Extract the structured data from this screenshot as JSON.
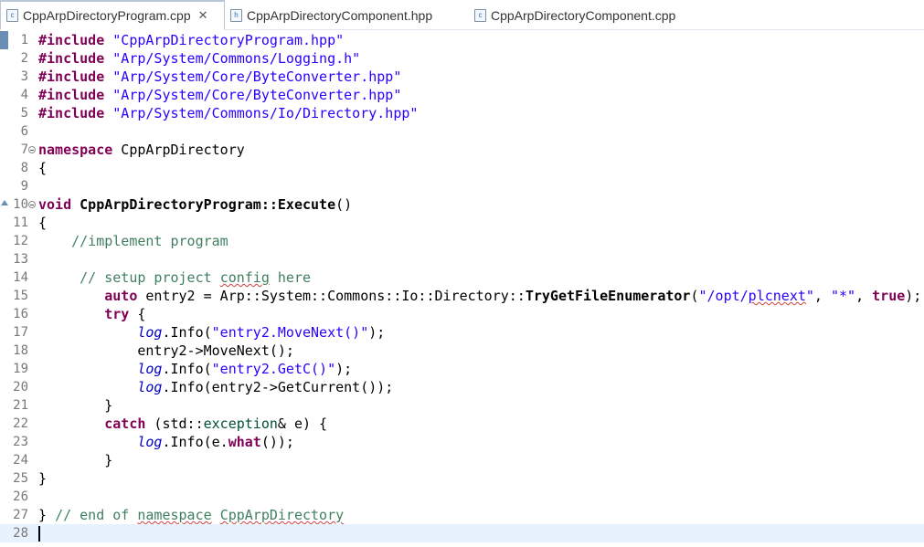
{
  "tabs": [
    {
      "icon": "cpp-file-icon",
      "icon_glyph": "c",
      "label": "CppArpDirectoryProgram.cpp",
      "active": true
    },
    {
      "icon": "header-file-icon",
      "icon_glyph": "h",
      "label": "CppArpDirectoryComponent.hpp",
      "active": false
    },
    {
      "icon": "cpp-file-icon",
      "icon_glyph": "c",
      "label": "CppArpDirectoryComponent.cpp",
      "active": false
    }
  ],
  "close_glyph": "✕",
  "lines": [
    {
      "n": "1",
      "t": [
        [
          "pp",
          "#include"
        ],
        [
          "",
          ""
        ],
        [
          "str",
          " \"CppArpDirectoryProgram.hpp\""
        ]
      ]
    },
    {
      "n": "2",
      "t": [
        [
          "pp",
          "#include"
        ],
        [
          "str",
          " \"Arp/System/Commons/Logging.h\""
        ]
      ]
    },
    {
      "n": "3",
      "t": [
        [
          "pp",
          "#include"
        ],
        [
          "str",
          " \"Arp/System/Core/ByteConverter.hpp\""
        ]
      ]
    },
    {
      "n": "4",
      "t": [
        [
          "pp",
          "#include"
        ],
        [
          "str",
          " \"Arp/System/Core/ByteConverter.hpp\""
        ]
      ]
    },
    {
      "n": "5",
      "t": [
        [
          "pp",
          "#include"
        ],
        [
          "str",
          " \"Arp/System/Commons/Io/Directory.hpp\""
        ]
      ]
    },
    {
      "n": "6",
      "t": []
    },
    {
      "n": "7",
      "fold": true,
      "t": [
        [
          "kw",
          "namespace"
        ],
        [
          "",
          " CppArpDirectory"
        ]
      ]
    },
    {
      "n": "8",
      "t": [
        [
          "",
          "{"
        ]
      ]
    },
    {
      "n": "9",
      "t": []
    },
    {
      "n": "10",
      "fold": true,
      "override": true,
      "t": [
        [
          "kw",
          "void"
        ],
        [
          "",
          " "
        ],
        [
          "fn",
          "CppArpDirectoryProgram::Execute"
        ],
        [
          "",
          "()"
        ]
      ]
    },
    {
      "n": "11",
      "t": [
        [
          "",
          "{"
        ]
      ]
    },
    {
      "n": "12",
      "t": [
        [
          "",
          "    "
        ],
        [
          "cm",
          "//implement program"
        ]
      ]
    },
    {
      "n": "13",
      "t": []
    },
    {
      "n": "14",
      "t": [
        [
          "",
          "     "
        ],
        [
          "cm",
          "// setup project "
        ],
        [
          "cm squig",
          "config"
        ],
        [
          "cm",
          " here"
        ]
      ]
    },
    {
      "n": "15",
      "t": [
        [
          "",
          "        "
        ],
        [
          "kw",
          "auto"
        ],
        [
          "",
          " entry2 = Arp::System::Commons::Io::Directory::"
        ],
        [
          "fn",
          "TryGetFileEnumerator"
        ],
        [
          "",
          "("
        ],
        [
          "str",
          "\"/opt/"
        ],
        [
          "str squig",
          "plcnext"
        ],
        [
          "str",
          "\""
        ],
        [
          "",
          ", "
        ],
        [
          "str",
          "\"*\""
        ],
        [
          "",
          ", "
        ],
        [
          "kw",
          "true"
        ],
        [
          "",
          ");"
        ]
      ]
    },
    {
      "n": "16",
      "t": [
        [
          "",
          "        "
        ],
        [
          "kw",
          "try"
        ],
        [
          "",
          " {"
        ]
      ]
    },
    {
      "n": "17",
      "t": [
        [
          "",
          "            "
        ],
        [
          "field",
          "log"
        ],
        [
          "",
          ".Info("
        ],
        [
          "str",
          "\"entry2.MoveNext()\""
        ],
        [
          "",
          ");"
        ]
      ]
    },
    {
      "n": "18",
      "t": [
        [
          "",
          "            entry2->MoveNext();"
        ]
      ]
    },
    {
      "n": "19",
      "t": [
        [
          "",
          "            "
        ],
        [
          "field",
          "log"
        ],
        [
          "",
          ".Info("
        ],
        [
          "str",
          "\"entry2.GetC()\""
        ],
        [
          "",
          ");"
        ]
      ]
    },
    {
      "n": "20",
      "t": [
        [
          "",
          "            "
        ],
        [
          "field",
          "log"
        ],
        [
          "",
          ".Info(entry2->GetCurrent());"
        ]
      ]
    },
    {
      "n": "21",
      "t": [
        [
          "",
          "        }"
        ]
      ]
    },
    {
      "n": "22",
      "t": [
        [
          "",
          "        "
        ],
        [
          "kw",
          "catch"
        ],
        [
          "",
          " (std::"
        ],
        [
          "typ",
          "exception"
        ],
        [
          "",
          "& e) {"
        ]
      ]
    },
    {
      "n": "23",
      "t": [
        [
          "",
          "            "
        ],
        [
          "field",
          "log"
        ],
        [
          "",
          ".Info(e."
        ],
        [
          "kw",
          "what"
        ],
        [
          "",
          "());"
        ]
      ]
    },
    {
      "n": "24",
      "t": [
        [
          "",
          "        }"
        ]
      ]
    },
    {
      "n": "25",
      "t": [
        [
          "",
          "}"
        ]
      ]
    },
    {
      "n": "26",
      "t": []
    },
    {
      "n": "27",
      "t": [
        [
          "",
          "} "
        ],
        [
          "cm",
          "// end of "
        ],
        [
          "cm squig",
          "namespace"
        ],
        [
          "cm",
          " "
        ],
        [
          "cm squig",
          "CppArpDirectory"
        ]
      ]
    },
    {
      "n": "28",
      "current": true,
      "t": []
    }
  ]
}
